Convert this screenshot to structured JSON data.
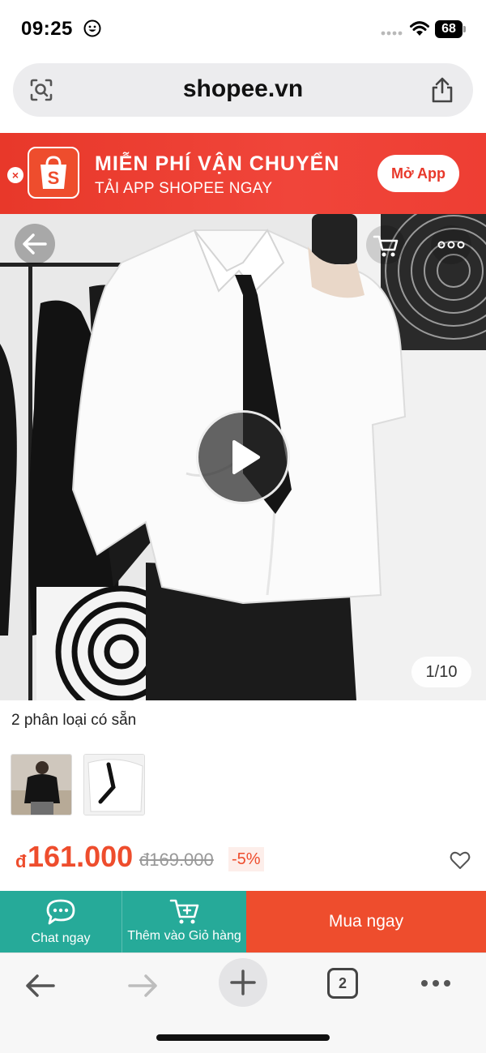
{
  "status_bar": {
    "time": "09:25",
    "battery": "68"
  },
  "browser": {
    "url": "shopee.vn",
    "tab_count": "2"
  },
  "banner": {
    "title": "MIỄN PHÍ VẬN CHUYỂN",
    "subtitle": "TẢI APP SHOPEE NGAY",
    "open_app_label": "Mở App",
    "close_label": "×"
  },
  "gallery": {
    "counter": "1/10"
  },
  "variants": {
    "label": "2 phân loại có sẵn"
  },
  "price": {
    "currency": "đ",
    "current": "161.000",
    "original": "đ169.000",
    "discount": "-5%"
  },
  "actions": {
    "chat_label": "Chat ngay",
    "cart_label": "Thêm vào Giỏ hàng",
    "buy_label": "Mua ngay"
  },
  "colors": {
    "brand": "#ee4d2d",
    "teal": "#26aa99"
  }
}
